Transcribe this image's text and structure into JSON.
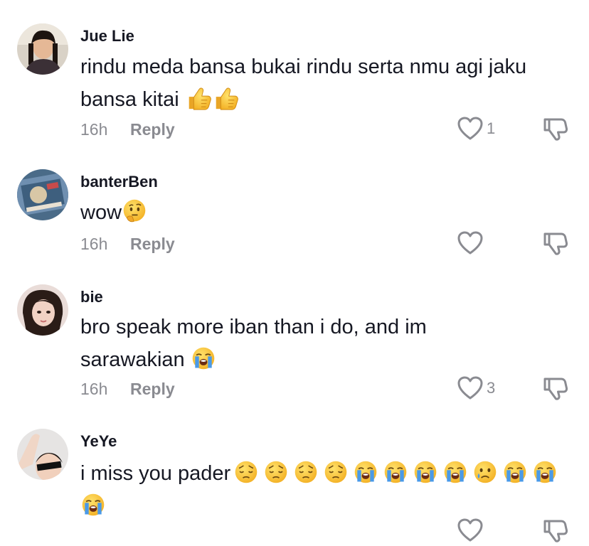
{
  "comments": [
    {
      "username": "Jue Lie",
      "text_line1": "rindu meda bansa bukai rindu serta nmu agi jaku",
      "text_line2": "bansa kitai",
      "emojis": [
        "thumbs-up",
        "thumbs-up"
      ],
      "time": "16h",
      "reply": "Reply",
      "likes": "1"
    },
    {
      "username": "banterBen",
      "text_line1": "wow",
      "emojis": [
        "thinking-face"
      ],
      "time": "16h",
      "reply": "Reply",
      "likes": ""
    },
    {
      "username": "bie",
      "text_line1": "bro speak more iban than i do, and im",
      "text_line2": "sarawakian",
      "emojis": [
        "loudly-crying-face"
      ],
      "time": "16h",
      "reply": "Reply",
      "likes": "3"
    },
    {
      "username": "YeYe",
      "text_line1": "i miss you pader",
      "emojis": [
        "pensive-face",
        "pensive-face",
        "pensive-face",
        "pensive-face",
        "loudly-crying-face",
        "loudly-crying-face",
        "loudly-crying-face",
        "loudly-crying-face",
        "sad-tear-face",
        "loudly-crying-face",
        "loudly-crying-face",
        "loudly-crying-face"
      ]
    }
  ],
  "colors": {
    "text": "#161823",
    "secondary": "#8a8b91",
    "emoji_yellow": "#f7c12f",
    "tear_blue": "#4a9ae8"
  },
  "icons": [
    "heart-icon",
    "thumbs-down-icon"
  ]
}
